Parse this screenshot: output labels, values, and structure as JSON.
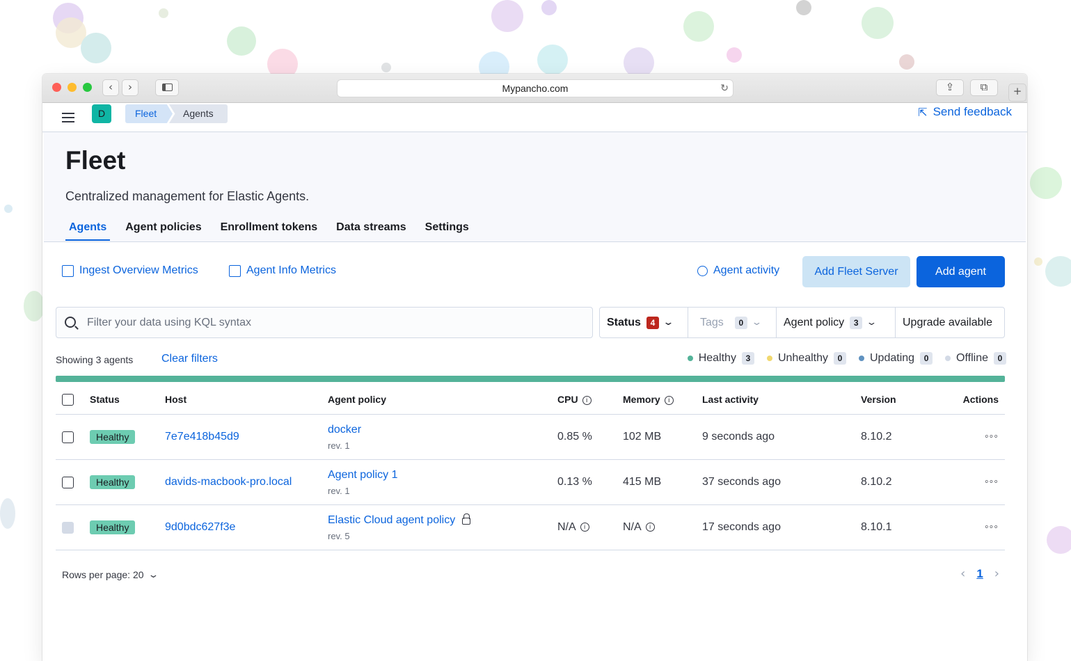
{
  "browser": {
    "url": "Mypancho.com",
    "back_icon": "chevron-left-icon",
    "forward_icon": "chevron-right-icon"
  },
  "header": {
    "space_initial": "D",
    "breadcrumbs": [
      "Fleet",
      "Agents"
    ],
    "feedback_label": "Send feedback"
  },
  "page": {
    "title": "Fleet",
    "description": "Centralized management for Elastic Agents.",
    "tabs": [
      "Agents",
      "Agent policies",
      "Enrollment tokens",
      "Data streams",
      "Settings"
    ],
    "active_tab": "Agents"
  },
  "actions": {
    "ingest_metrics": "Ingest Overview Metrics",
    "agent_info_metrics": "Agent Info Metrics",
    "agent_activity": "Agent activity",
    "add_fleet_server": "Add Fleet Server",
    "add_agent": "Add agent"
  },
  "search": {
    "placeholder": "Filter your data using KQL syntax"
  },
  "filters": [
    {
      "label": "Status",
      "count": "4"
    },
    {
      "label": "Tags",
      "count": "0"
    },
    {
      "label": "Agent policy",
      "count": "3"
    },
    {
      "label": "Upgrade available"
    }
  ],
  "summary": {
    "showing": "Showing 3 agents",
    "clear_filters": "Clear filters",
    "legend": [
      {
        "label": "Healthy",
        "count": "3",
        "color": "#54b399"
      },
      {
        "label": "Unhealthy",
        "count": "0",
        "color": "#f1d86f"
      },
      {
        "label": "Updating",
        "count": "0",
        "color": "#6092c0"
      },
      {
        "label": "Offline",
        "count": "0",
        "color": "#d3dae6"
      }
    ]
  },
  "table": {
    "columns": [
      "Status",
      "Host",
      "Agent policy",
      "CPU",
      "Memory",
      "Last activity",
      "Version",
      "Actions"
    ],
    "rows": [
      {
        "status": "Healthy",
        "host": "7e7e418b45d9",
        "policy": "docker",
        "rev": "rev. 1",
        "cpu": "0.85 %",
        "memory": "102 MB",
        "last_activity": "9 seconds ago",
        "version": "8.10.2"
      },
      {
        "status": "Healthy",
        "host": "davids-macbook-pro.local",
        "policy": "Agent policy 1",
        "rev": "rev. 1",
        "cpu": "0.13 %",
        "memory": "415 MB",
        "last_activity": "37 seconds ago",
        "version": "8.10.2"
      },
      {
        "status": "Healthy",
        "host": "9d0bdc627f3e",
        "policy": "Elastic Cloud agent policy",
        "rev": "rev. 5",
        "cpu": "N/A",
        "memory": "N/A",
        "last_activity": "17 seconds ago",
        "version": "8.10.1"
      }
    ]
  },
  "pagination": {
    "rows_per_page": "Rows per page: 20",
    "current_page": "1"
  },
  "colors": {
    "accent": "#0b64dd",
    "healthy": "#6dccb1",
    "danger_badge": "#bd271e"
  }
}
